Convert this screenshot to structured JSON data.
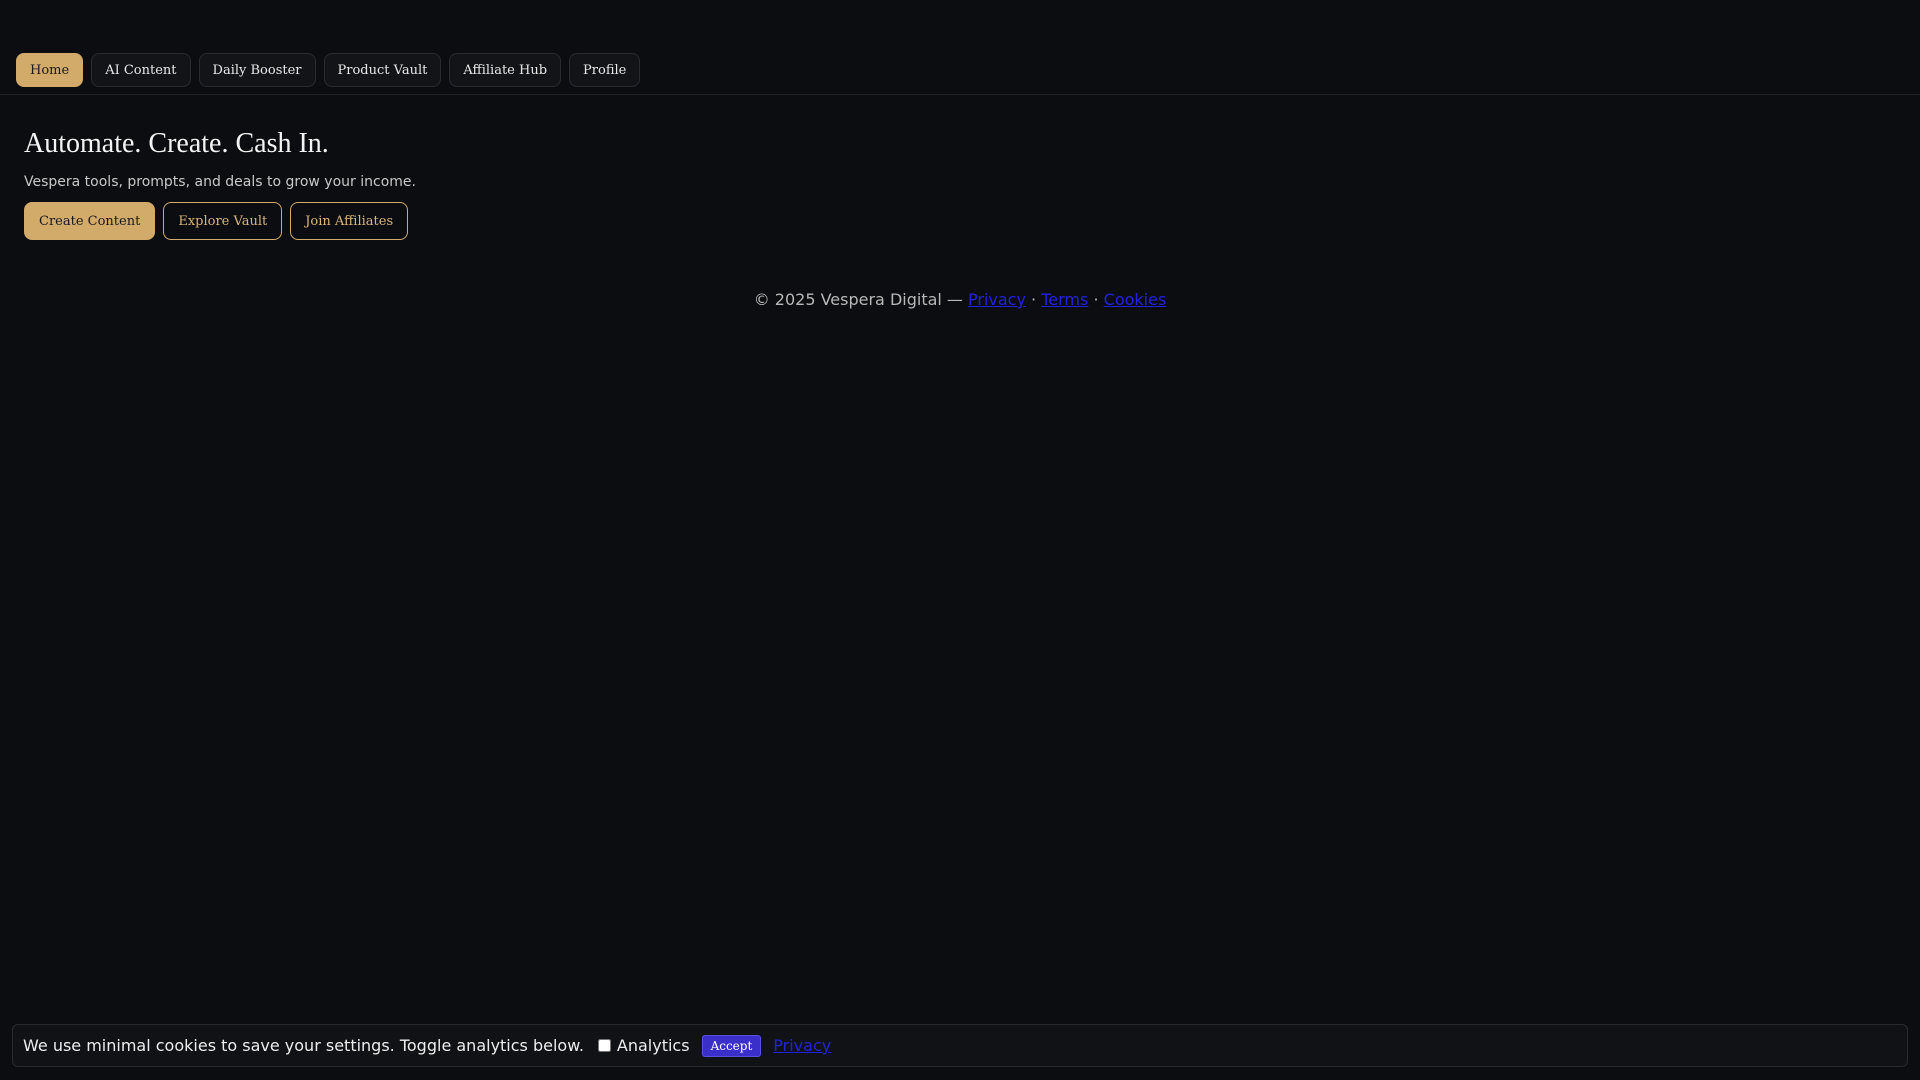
{
  "nav": {
    "tabs": [
      {
        "label": "Home",
        "active": true
      },
      {
        "label": "AI Content"
      },
      {
        "label": "Daily Booster"
      },
      {
        "label": "Product Vault"
      },
      {
        "label": "Affiliate Hub"
      },
      {
        "label": "Profile"
      }
    ]
  },
  "hero": {
    "title": "Automate. Create. Cash In.",
    "subtitle": "Vespera tools, prompts, and deals to grow your income.",
    "buttons": [
      {
        "label": "Create Content",
        "style": "primary"
      },
      {
        "label": "Explore Vault",
        "style": "outline"
      },
      {
        "label": "Join Affiliates",
        "style": "outline"
      }
    ]
  },
  "footer": {
    "copyright": "© 2025 Vespera Digital —",
    "links": [
      "Privacy",
      "Terms",
      "Cookies"
    ],
    "separator": "·"
  },
  "cookie_bar": {
    "message": "We use minimal cookies to save your settings. Toggle analytics below.",
    "analytics_label": "Analytics",
    "analytics_checked": false,
    "accept_label": "Accept",
    "privacy_label": "Privacy"
  },
  "colors": {
    "background": "#0c0d10",
    "accent": "#d2aa6a",
    "accept": "#3b2fc9",
    "link": "#2222dd"
  }
}
